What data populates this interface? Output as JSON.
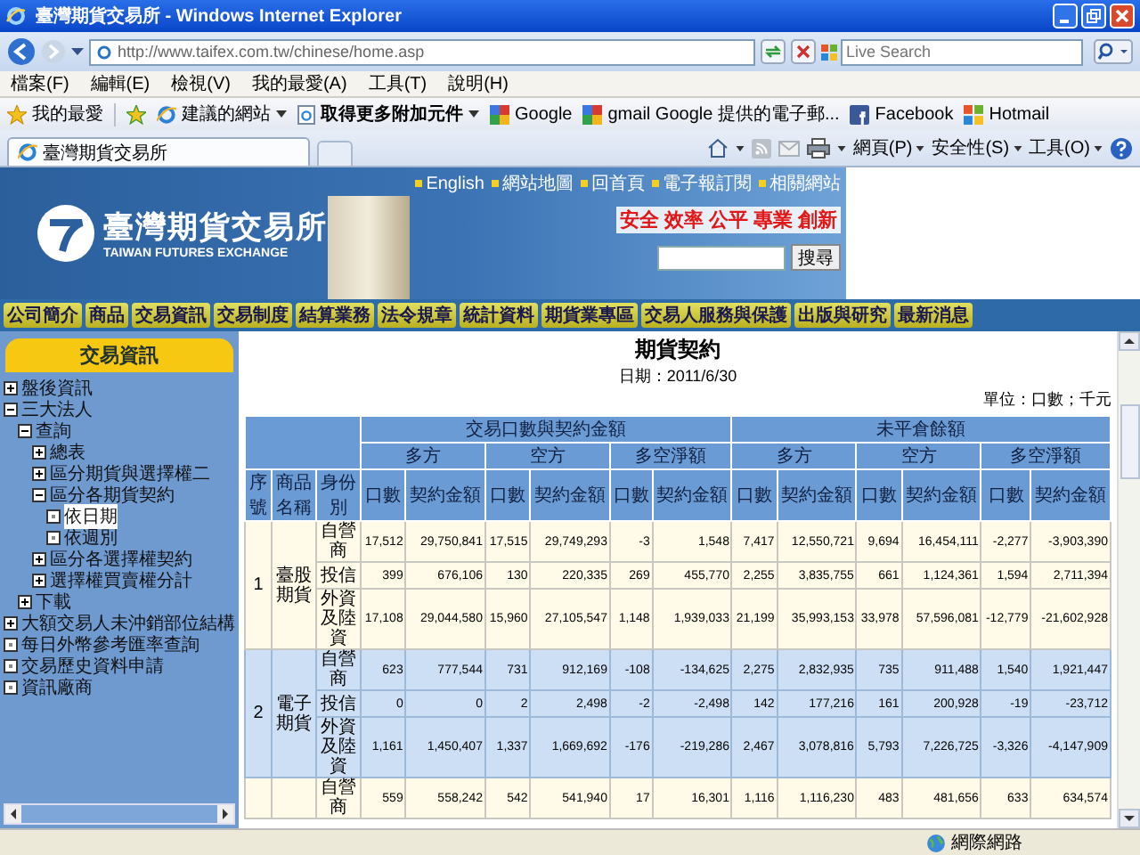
{
  "window": {
    "title": "臺灣期貨交易所 - Windows Internet Explorer"
  },
  "address_bar": {
    "url": "http://www.taifex.com.tw/chinese/home.asp",
    "search_placeholder": "Live Search"
  },
  "menu": [
    "檔案(F)",
    "編輯(E)",
    "檢視(V)",
    "我的最愛(A)",
    "工具(T)",
    "說明(H)"
  ],
  "favorites_bar": {
    "favorites_label": "我的最愛",
    "links": [
      {
        "label": "建議的網站",
        "kind": "ie",
        "bold": false,
        "dropdown": true
      },
      {
        "label": "取得更多附加元件",
        "kind": "page",
        "bold": true,
        "dropdown": true
      },
      {
        "label": "Google",
        "kind": "google",
        "bold": false,
        "dropdown": false
      },
      {
        "label": "gmail Google 提供的電子郵...",
        "kind": "google",
        "bold": false,
        "dropdown": false
      },
      {
        "label": "Facebook",
        "kind": "facebook",
        "bold": false,
        "dropdown": false
      },
      {
        "label": "Hotmail",
        "kind": "windows",
        "bold": false,
        "dropdown": false
      }
    ]
  },
  "tabs": [
    {
      "label": "臺灣期貨交易所",
      "selected": true
    }
  ],
  "command_bar": [
    "網頁(P)",
    "安全性(S)",
    "工具(O)"
  ],
  "site_header": {
    "top_links": [
      "English",
      "網站地圖",
      "回首頁",
      "電子報訂閱",
      "相關網站"
    ],
    "logo_text": "臺灣期貨交易所",
    "logo_subtitle": "TAIWAN FUTURES EXCHANGE",
    "slogan": "安全 效率 公平 專業 創新",
    "search_button": "搜尋"
  },
  "nav": [
    "公司簡介",
    "商品",
    "交易資訊",
    "交易制度",
    "結算業務",
    "法令規章",
    "統計資料",
    "期貨業專區",
    "交易人服務與保護",
    "出版與研究",
    "最新消息"
  ],
  "sidebar": {
    "title": "交易資訊",
    "tree": [
      {
        "label": "盤後資訊",
        "kind": "node",
        "expanded": false,
        "selected": false
      },
      {
        "label": "三大法人",
        "kind": "node",
        "expanded": true,
        "selected": false,
        "children": [
          {
            "label": "查詢",
            "kind": "node",
            "expanded": true,
            "selected": false,
            "children": [
              {
                "label": "總表",
                "kind": "node",
                "expanded": false,
                "selected": false
              },
              {
                "label": "區分期貨與選擇權二",
                "kind": "node",
                "expanded": false,
                "selected": false
              },
              {
                "label": "區分各期貨契約",
                "kind": "node",
                "expanded": true,
                "selected": false,
                "children": [
                  {
                    "label": "依日期",
                    "kind": "leaf",
                    "selected": true
                  },
                  {
                    "label": "依週別",
                    "kind": "leaf",
                    "selected": false
                  }
                ]
              },
              {
                "label": "區分各選擇權契約",
                "kind": "node",
                "expanded": false,
                "selected": false
              },
              {
                "label": "選擇權買賣權分計",
                "kind": "node",
                "expanded": false,
                "selected": false
              }
            ]
          },
          {
            "label": "下載",
            "kind": "node",
            "expanded": false,
            "selected": false
          }
        ]
      },
      {
        "label": "大額交易人未沖銷部位結構",
        "kind": "node",
        "expanded": false,
        "selected": false
      },
      {
        "label": "每日外幣參考匯率查詢",
        "kind": "leaf",
        "selected": false
      },
      {
        "label": "交易歷史資料申請",
        "kind": "leaf",
        "selected": false
      },
      {
        "label": "資訊廠商",
        "kind": "leaf",
        "selected": false
      }
    ]
  },
  "report": {
    "title": "期貨契約",
    "date": "日期：2011/6/30",
    "unit": "單位：口數；千元",
    "table": {
      "fixed_columns": [
        "序號",
        "商品名稱",
        "身份別"
      ],
      "header_groups": [
        {
          "label": "交易口數與契約金額",
          "sides": [
            {
              "label": "多方",
              "columns": [
                "口數",
                "契約金額"
              ]
            },
            {
              "label": "空方",
              "columns": [
                "口數",
                "契約金額"
              ]
            },
            {
              "label": "多空淨額",
              "columns": [
                "口數",
                "契約金額"
              ]
            }
          ]
        },
        {
          "label": "未平倉餘額",
          "sides": [
            {
              "label": "多方",
              "columns": [
                "口數",
                "契約金額"
              ]
            },
            {
              "label": "空方",
              "columns": [
                "口數",
                "契約金額"
              ]
            },
            {
              "label": "多空淨額",
              "columns": [
                "口數",
                "契約金額"
              ]
            }
          ]
        }
      ],
      "groups": [
        {
          "seq": "1",
          "product": "臺股期貨",
          "rows": [
            {
              "identity": "自營商",
              "values": [
                "17,512",
                "29,750,841",
                "17,515",
                "29,749,293",
                "-3",
                "1,548",
                "7,417",
                "12,550,721",
                "9,694",
                "16,454,111",
                "-2,277",
                "-3,903,390"
              ]
            },
            {
              "identity": "投信",
              "values": [
                "399",
                "676,106",
                "130",
                "220,335",
                "269",
                "455,770",
                "2,255",
                "3,835,755",
                "661",
                "1,124,361",
                "1,594",
                "2,711,394"
              ]
            },
            {
              "identity": "外資及陸資",
              "values": [
                "17,108",
                "29,044,580",
                "15,960",
                "27,105,547",
                "1,148",
                "1,939,033",
                "21,199",
                "35,993,153",
                "33,978",
                "57,596,081",
                "-12,779",
                "-21,602,928"
              ]
            }
          ]
        },
        {
          "seq": "2",
          "product": "電子期貨",
          "rows": [
            {
              "identity": "自營商",
              "values": [
                "623",
                "777,544",
                "731",
                "912,169",
                "-108",
                "-134,625",
                "2,275",
                "2,832,935",
                "735",
                "911,488",
                "1,540",
                "1,921,447"
              ]
            },
            {
              "identity": "投信",
              "values": [
                "0",
                "0",
                "2",
                "2,498",
                "-2",
                "-2,498",
                "142",
                "177,216",
                "161",
                "200,928",
                "-19",
                "-23,712"
              ]
            },
            {
              "identity": "外資及陸資",
              "values": [
                "1,161",
                "1,450,407",
                "1,337",
                "1,669,692",
                "-176",
                "-219,286",
                "2,467",
                "3,078,816",
                "5,793",
                "7,226,725",
                "-3,326",
                "-4,147,909"
              ]
            }
          ]
        },
        {
          "rows": [
            {
              "identity": "自營商",
              "values": [
                "559",
                "558,242",
                "542",
                "541,940",
                "17",
                "16,301",
                "1,116",
                "1,116,230",
                "483",
                "481,656",
                "633",
                "634,574"
              ]
            }
          ]
        }
      ]
    }
  },
  "status_bar": {
    "zone": "網際網路"
  }
}
